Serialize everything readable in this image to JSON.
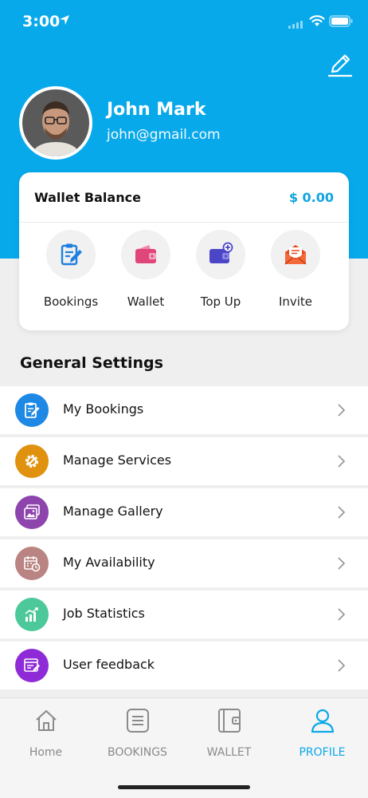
{
  "status_bar": {
    "time": "3:00"
  },
  "profile": {
    "name": "John Mark",
    "email": "john@gmail.com"
  },
  "wallet": {
    "label": "Wallet Balance",
    "value": "$ 0.00"
  },
  "quick_actions": [
    {
      "label": "Bookings",
      "icon": "clipboard-edit-icon"
    },
    {
      "label": "Wallet",
      "icon": "wallet-icon"
    },
    {
      "label": "Top Up",
      "icon": "wallet-plus-icon"
    },
    {
      "label": "Invite",
      "icon": "envelope-icon"
    }
  ],
  "general_settings": {
    "title": "General Settings",
    "items": [
      {
        "label": "My Bookings",
        "icon": "clipboard-edit-icon",
        "color": "#1e88e5"
      },
      {
        "label": "Manage Services",
        "icon": "gear-wrench-icon",
        "color": "#e0920f"
      },
      {
        "label": "Manage Gallery",
        "icon": "gallery-icon",
        "color": "#8e44ad"
      },
      {
        "label": "My Availability",
        "icon": "calendar-clock-icon",
        "color": "#b98481"
      },
      {
        "label": "Job Statistics",
        "icon": "bar-chart-icon",
        "color": "#4cc89a"
      },
      {
        "label": "User feedback",
        "icon": "feedback-icon",
        "color": "#8e2bd6"
      }
    ]
  },
  "tab_bar": {
    "tabs": [
      {
        "label": "Home",
        "icon": "home-icon",
        "active": false
      },
      {
        "label": "BOOKINGS",
        "icon": "list-icon",
        "active": false
      },
      {
        "label": "WALLET",
        "icon": "wallet-icon",
        "active": false
      },
      {
        "label": "PROFILE",
        "icon": "user-icon",
        "active": true
      }
    ]
  },
  "colors": {
    "header": "#08a9ea",
    "accent": "#0aa8e8",
    "background": "#efefef"
  }
}
